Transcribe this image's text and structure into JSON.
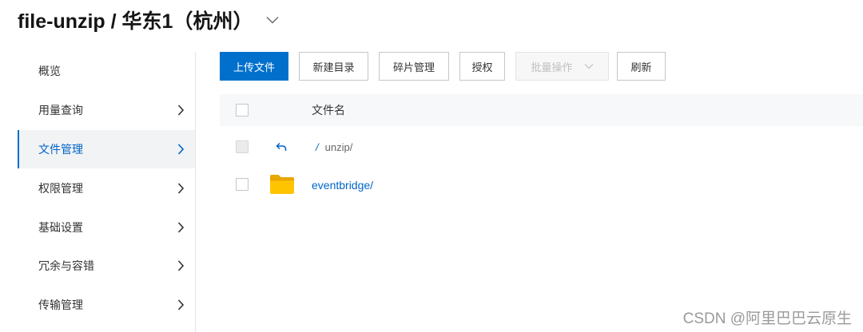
{
  "page": {
    "title": "file-unzip / 华东1（杭州）",
    "title_icon": "chevron-down-icon"
  },
  "sidebar": {
    "arrow_icon": "chevron-right-icon",
    "items": [
      {
        "label": "概览",
        "has_chevron": false,
        "active": false
      },
      {
        "label": "用量查询",
        "has_chevron": true,
        "active": false
      },
      {
        "label": "文件管理",
        "has_chevron": true,
        "active": true
      },
      {
        "label": "权限管理",
        "has_chevron": true,
        "active": false
      },
      {
        "label": "基础设置",
        "has_chevron": true,
        "active": false
      },
      {
        "label": "冗余与容错",
        "has_chevron": true,
        "active": false
      },
      {
        "label": "传输管理",
        "has_chevron": true,
        "active": false
      }
    ]
  },
  "toolbar": {
    "upload_label": "上传文件",
    "new_folder_label": "新建目录",
    "fragments_label": "碎片管理",
    "authorize_label": "授权",
    "batch_label": "批量操作",
    "batch_disabled": true,
    "batch_icon": "chevron-down-icon",
    "refresh_label": "刷新"
  },
  "file_table": {
    "columns": [
      "文件名"
    ],
    "rows": [
      {
        "is_parent": true,
        "icon": "back-arrow-icon",
        "root_link": "/",
        "path": "unzip/",
        "checkbox_disabled": true
      },
      {
        "is_parent": false,
        "icon": "folder-icon",
        "name": "eventbridge/",
        "checkbox_disabled": false
      }
    ]
  },
  "watermark": "CSDN @阿里巴巴云原生",
  "colors": {
    "accent": "#0070cc",
    "link": "#0064c8",
    "active_bg": "#f2f3f5",
    "header_bg": "#f7f8fa",
    "folder": "#ffc400",
    "folder_tab": "#e8a600",
    "disabled_text": "#c0c0c0"
  }
}
